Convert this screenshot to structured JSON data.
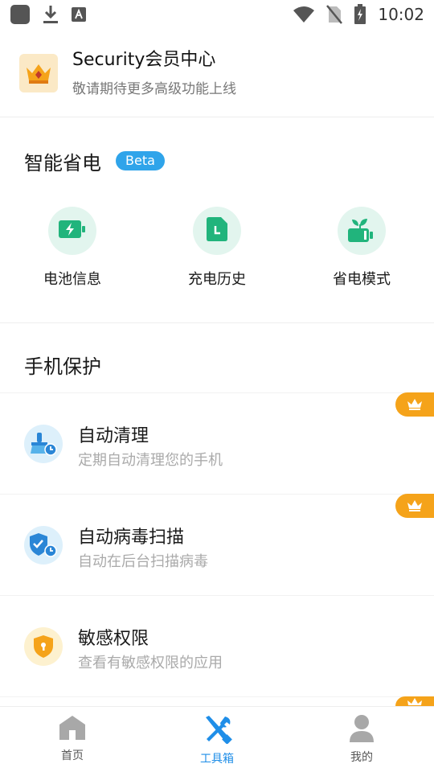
{
  "status_bar": {
    "time": "10:02"
  },
  "vip": {
    "title": "Security会员中心",
    "subtitle": "敬请期待更多高级功能上线"
  },
  "power_saving": {
    "title": "智能省电",
    "badge": "Beta",
    "items": [
      {
        "label": "电池信息",
        "icon": "battery-charging-icon"
      },
      {
        "label": "充电历史",
        "icon": "charge-history-icon"
      },
      {
        "label": "省电模式",
        "icon": "power-save-mode-icon"
      }
    ]
  },
  "protection": {
    "title": "手机保护",
    "items": [
      {
        "title": "自动清理",
        "subtitle": "定期自动清理您的手机",
        "icon": "auto-clean-icon",
        "premium": true
      },
      {
        "title": "自动病毒扫描",
        "subtitle": "自动在后台扫描病毒",
        "icon": "virus-scan-icon",
        "premium": true
      },
      {
        "title": "敏感权限",
        "subtitle": "查看有敏感权限的应用",
        "icon": "sensitive-permission-icon",
        "premium": false
      }
    ]
  },
  "bottom_nav": {
    "items": [
      {
        "label": "首页",
        "icon": "home-icon",
        "active": false
      },
      {
        "label": "工具箱",
        "icon": "toolbox-icon",
        "active": true
      },
      {
        "label": "我的",
        "icon": "profile-icon",
        "active": false
      }
    ]
  },
  "colors": {
    "accent": "#1f8ee8",
    "green": "#21b47c",
    "premium": "#f5a31a",
    "beta": "#2fa4ea"
  }
}
